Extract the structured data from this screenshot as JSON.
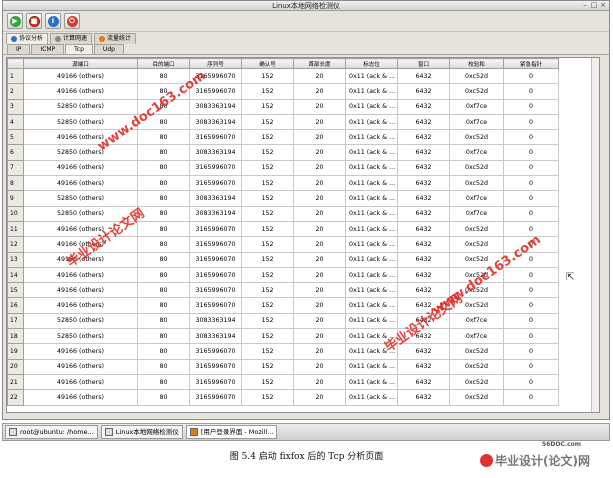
{
  "window": {
    "title": "Linux本地网络检测仪"
  },
  "toolbar": {
    "buttons": [
      {
        "name": "start",
        "glyph": "▶",
        "color": "#3aa33a"
      },
      {
        "name": "stop",
        "glyph": "■",
        "color": "#d23b2b"
      },
      {
        "name": "info",
        "glyph": "i",
        "color": "#2f6fc1"
      },
      {
        "name": "power",
        "glyph": "⏻",
        "color": "#d23b2b"
      }
    ]
  },
  "main_tabs": [
    {
      "label": "协议分析",
      "active": true
    },
    {
      "label": "计算网速",
      "active": false
    },
    {
      "label": "流量统计",
      "active": false
    }
  ],
  "protocol_tabs": [
    {
      "label": "IP",
      "active": false
    },
    {
      "label": "ICMP",
      "active": false
    },
    {
      "label": "Tcp",
      "active": true
    },
    {
      "label": "Udp",
      "active": false
    }
  ],
  "table": {
    "columns": [
      "",
      "源端口",
      "目的端口",
      "序列号",
      "确认号",
      "首部长度",
      "标志位",
      "窗口",
      "校验和",
      "紧急指针"
    ],
    "rows": [
      [
        "1",
        "49166 (others)",
        "80",
        "3165996070",
        "152",
        "20",
        "0x11 (ack & ...",
        "6432",
        "0xc52d",
        "0"
      ],
      [
        "2",
        "49166 (others)",
        "80",
        "3165996070",
        "152",
        "20",
        "0x11 (ack & ...",
        "6432",
        "0xc52d",
        "0"
      ],
      [
        "3",
        "52850 (others)",
        "80",
        "3083363194",
        "152",
        "20",
        "0x11 (ack & ...",
        "6432",
        "0xf7ce",
        "0"
      ],
      [
        "4",
        "52850 (others)",
        "80",
        "3083363194",
        "152",
        "20",
        "0x11 (ack & ...",
        "6432",
        "0xf7ce",
        "0"
      ],
      [
        "5",
        "49166 (others)",
        "80",
        "3165996070",
        "152",
        "20",
        "0x11 (ack & ...",
        "6432",
        "0xc52d",
        "0"
      ],
      [
        "6",
        "52850 (others)",
        "80",
        "3083363194",
        "152",
        "20",
        "0x11 (ack & ...",
        "6432",
        "0xf7ce",
        "0"
      ],
      [
        "7",
        "49166 (others)",
        "80",
        "3165996070",
        "152",
        "20",
        "0x11 (ack & ...",
        "6432",
        "0xc52d",
        "0"
      ],
      [
        "8",
        "49166 (others)",
        "80",
        "3165996070",
        "152",
        "20",
        "0x11 (ack & ...",
        "6432",
        "0xc52d",
        "0"
      ],
      [
        "9",
        "52850 (others)",
        "80",
        "3083363194",
        "152",
        "20",
        "0x11 (ack & ...",
        "6432",
        "0xf7ce",
        "0"
      ],
      [
        "10",
        "52850 (others)",
        "80",
        "3083363194",
        "152",
        "20",
        "0x11 (ack & ...",
        "6432",
        "0xf7ce",
        "0"
      ],
      [
        "11",
        "49166 (others)",
        "80",
        "3165996070",
        "152",
        "20",
        "0x11 (ack & ...",
        "6432",
        "0xc52d",
        "0"
      ],
      [
        "12",
        "49166 (others)",
        "80",
        "3165996070",
        "152",
        "20",
        "0x11 (ack & ...",
        "6432",
        "0xc52d",
        "0"
      ],
      [
        "13",
        "49166 (others)",
        "80",
        "3165996070",
        "152",
        "20",
        "0x11 (ack & ...",
        "6432",
        "0xc52d",
        "0"
      ],
      [
        "14",
        "49166 (others)",
        "80",
        "3165996070",
        "152",
        "20",
        "0x11 (ack & ...",
        "6432",
        "0xc52d",
        "0"
      ],
      [
        "15",
        "49166 (others)",
        "80",
        "3165996070",
        "152",
        "20",
        "0x11 (ack & ...",
        "6432",
        "0xc52d",
        "0"
      ],
      [
        "16",
        "49166 (others)",
        "80",
        "3165996070",
        "152",
        "20",
        "0x11 (ack & ...",
        "6432",
        "0xc52d",
        "0"
      ],
      [
        "17",
        "52850 (others)",
        "80",
        "3083363194",
        "152",
        "20",
        "0x11 (ack & ...",
        "6432",
        "0xf7ce",
        "0"
      ],
      [
        "18",
        "52850 (others)",
        "80",
        "3083363194",
        "152",
        "20",
        "0x11 (ack & ...",
        "6432",
        "0xf7ce",
        "0"
      ],
      [
        "19",
        "49166 (others)",
        "80",
        "3165996070",
        "152",
        "20",
        "0x11 (ack & ...",
        "6432",
        "0xc52d",
        "0"
      ],
      [
        "20",
        "49166 (others)",
        "80",
        "3165996070",
        "152",
        "20",
        "0x11 (ack & ...",
        "6432",
        "0xc52d",
        "0"
      ],
      [
        "21",
        "49166 (others)",
        "80",
        "3165996070",
        "152",
        "20",
        "0x11 (ack & ...",
        "6432",
        "0xc52d",
        "0"
      ],
      [
        "22",
        "49166 (others)",
        "80",
        "3165996070",
        "152",
        "20",
        "0x11 (ack & ...",
        "6432",
        "0xc52d",
        "0"
      ]
    ]
  },
  "taskbar": {
    "items": [
      {
        "label": "root@ubuntu: /home...",
        "active": false
      },
      {
        "label": "Linux本地网络检测仪",
        "active": false
      },
      {
        "label": "[用户登录界面 - Mozill...",
        "active": true
      }
    ]
  },
  "caption": "图 5.4 启动 fixfox 后的 Tcp 分析页面",
  "watermark": {
    "url_text": "www.doc163.com",
    "site_text": "毕业设计论文网",
    "logo_url": "56DOC.com",
    "logo_name": "毕业设计(论文)网",
    "color": "#e0231c"
  }
}
